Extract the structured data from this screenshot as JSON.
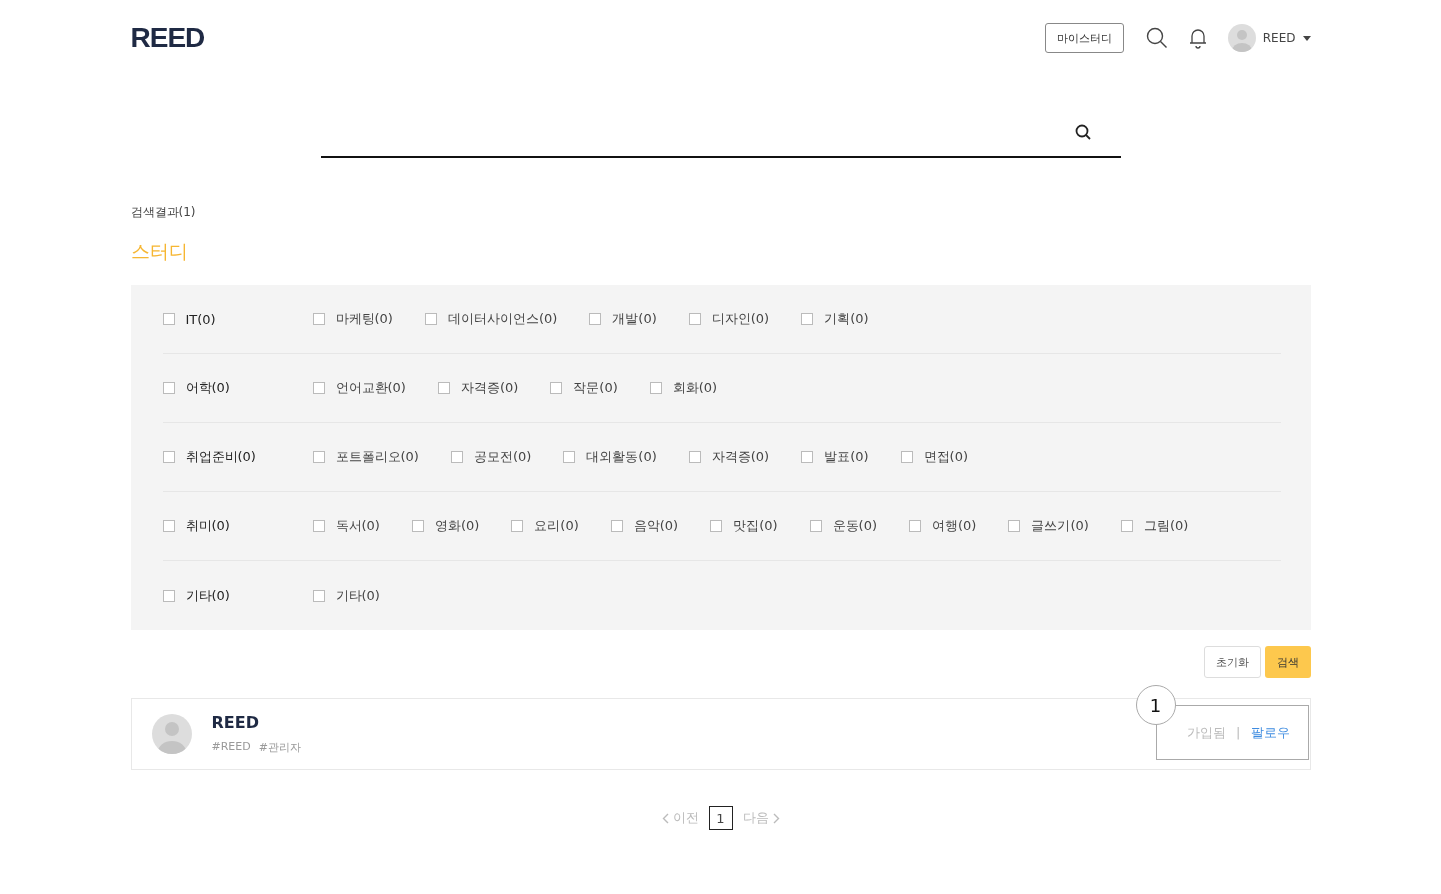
{
  "header": {
    "logo": "REED",
    "my_study_button": "마이스터디",
    "user_name": "REED"
  },
  "result_count": "검색결과(1)",
  "section_title": "스터디",
  "categories": [
    {
      "label": "IT(0)",
      "checked": false,
      "children": [
        {
          "label": "마케팅(0)",
          "checked": false
        },
        {
          "label": "데이터사이언스(0)",
          "checked": false
        },
        {
          "label": "개발(0)",
          "checked": false
        },
        {
          "label": "디자인(0)",
          "checked": false
        },
        {
          "label": "기획(0)",
          "checked": false
        }
      ]
    },
    {
      "label": "어학(0)",
      "checked": false,
      "children": [
        {
          "label": "언어교환(0)",
          "checked": false
        },
        {
          "label": "자격증(0)",
          "checked": false
        },
        {
          "label": "작문(0)",
          "checked": false
        },
        {
          "label": "회화(0)",
          "checked": false
        }
      ]
    },
    {
      "label": "취업준비(0)",
      "checked": false,
      "children": [
        {
          "label": "포트폴리오(0)",
          "checked": false
        },
        {
          "label": "공모전(0)",
          "checked": false
        },
        {
          "label": "대외활동(0)",
          "checked": false
        },
        {
          "label": "자격증(0)",
          "checked": false
        },
        {
          "label": "발표(0)",
          "checked": false
        },
        {
          "label": "면접(0)",
          "checked": false
        }
      ]
    },
    {
      "label": "취미(0)",
      "checked": false,
      "children": [
        {
          "label": "독서(0)",
          "checked": false
        },
        {
          "label": "영화(0)",
          "checked": false
        },
        {
          "label": "요리(0)",
          "checked": false
        },
        {
          "label": "음악(0)",
          "checked": false
        },
        {
          "label": "맛집(0)",
          "checked": false
        },
        {
          "label": "운동(0)",
          "checked": false
        },
        {
          "label": "여행(0)",
          "checked": false
        },
        {
          "label": "글쓰기(0)",
          "checked": false
        },
        {
          "label": "그림(0)",
          "checked": false
        }
      ]
    },
    {
      "label": "기타(0)",
      "checked": false,
      "children": [
        {
          "label": "기타(0)",
          "checked": false
        }
      ]
    }
  ],
  "buttons": {
    "reset": "초기화",
    "search": "검색"
  },
  "results": [
    {
      "name": "REED",
      "tags": [
        "#REED",
        "#관리자"
      ],
      "badge": "1",
      "joined": "가입됨",
      "separator": "|",
      "follow": "팔로우"
    }
  ],
  "pagination": {
    "prev": "이전",
    "next": "다음",
    "pages": [
      {
        "label": "1",
        "selected": true
      }
    ]
  }
}
